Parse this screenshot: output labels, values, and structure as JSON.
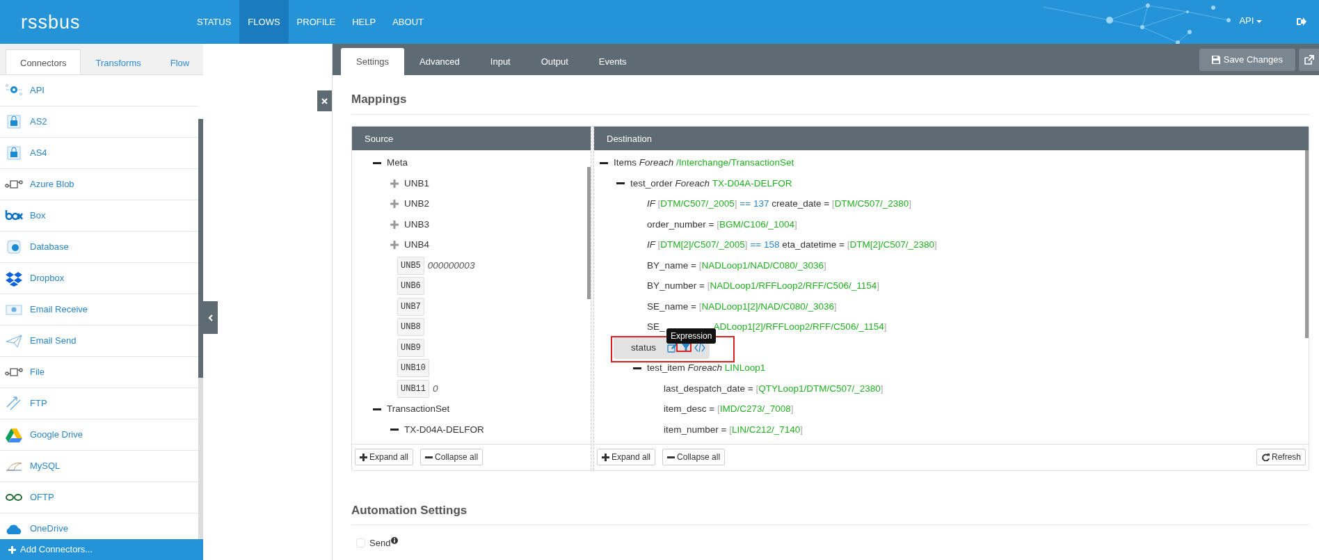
{
  "navbar": {
    "logo": "rssbus",
    "items": [
      {
        "label": "STATUS",
        "selected": false
      },
      {
        "label": "FLOWS",
        "selected": true
      },
      {
        "label": "PROFILE",
        "selected": false
      },
      {
        "label": "HELP",
        "selected": false
      },
      {
        "label": "ABOUT",
        "selected": false
      }
    ],
    "user_menu": "API"
  },
  "sidebar": {
    "tabs": [
      {
        "label": "Connectors",
        "selected": true
      },
      {
        "label": "Transforms",
        "selected": false
      },
      {
        "label": "Flow",
        "selected": false
      }
    ],
    "connectors": [
      "API",
      "AS2",
      "AS4",
      "Azure Blob",
      "Box",
      "Database",
      "Dropbox",
      "Email Receive",
      "Email Send",
      "File",
      "FTP",
      "Google Drive",
      "MySQL",
      "OFTP",
      "OneDrive"
    ],
    "add_button": "Add Connectors..."
  },
  "main": {
    "tabs": [
      {
        "label": "Settings",
        "selected": true
      },
      {
        "label": "Advanced",
        "selected": false
      },
      {
        "label": "Input",
        "selected": false
      },
      {
        "label": "Output",
        "selected": false
      },
      {
        "label": "Events",
        "selected": false
      }
    ],
    "save_button": "Save Changes",
    "mappings": {
      "title": "Mappings",
      "source": {
        "title": "Source",
        "nodes": [
          {
            "kind": "branch",
            "label": "Meta",
            "expanded": true,
            "children": [
              {
                "kind": "branch",
                "label": "UNB1",
                "expanded": false
              },
              {
                "kind": "branch",
                "label": "UNB2",
                "expanded": false
              },
              {
                "kind": "branch",
                "label": "UNB3",
                "expanded": false
              },
              {
                "kind": "branch",
                "label": "UNB4",
                "expanded": false
              },
              {
                "kind": "field",
                "label": "UNB5",
                "value": "000000003"
              },
              {
                "kind": "field",
                "label": "UNB6"
              },
              {
                "kind": "field",
                "label": "UNB7"
              },
              {
                "kind": "field",
                "label": "UNB8"
              },
              {
                "kind": "field",
                "label": "UNB9"
              },
              {
                "kind": "field",
                "label": "UNB10"
              },
              {
                "kind": "field",
                "label": "UNB11",
                "value": "0"
              }
            ]
          },
          {
            "kind": "branch",
            "label": "TransactionSet",
            "expanded": true,
            "children": [
              {
                "kind": "branch",
                "label": "TX-D04A-DELFOR",
                "expanded": true
              }
            ]
          }
        ],
        "buttons": [
          "Expand all",
          "Collapse all"
        ]
      },
      "destination": {
        "title": "Destination",
        "nodes": [
          {
            "kind": "loop",
            "expanded": true,
            "parts": [
              {
                "kind": "plain",
                "text": "Items "
              },
              {
                "kind": "kw",
                "text": "Foreach "
              },
              {
                "kind": "path",
                "text": "/Interchange/TransactionSet"
              }
            ],
            "children": [
              {
                "kind": "loop",
                "expanded": true,
                "parts": [
                  {
                    "kind": "plain",
                    "text": "test_order "
                  },
                  {
                    "kind": "kw",
                    "text": "Foreach "
                  },
                  {
                    "kind": "path",
                    "text": "TX-D04A-DELFOR"
                  }
                ],
                "children": [
                  {
                    "kind": "mapping",
                    "parts": [
                      {
                        "kind": "kw",
                        "text": "IF "
                      },
                      {
                        "kind": "br",
                        "text": "["
                      },
                      {
                        "kind": "path",
                        "text": "DTM/C507/_2005"
                      },
                      {
                        "kind": "br",
                        "text": "]"
                      },
                      {
                        "kind": "num",
                        "text": " == 137 "
                      },
                      {
                        "kind": "plain",
                        "text": "create_date = "
                      },
                      {
                        "kind": "br",
                        "text": "["
                      },
                      {
                        "kind": "path",
                        "text": "DTM/C507/_2380"
                      },
                      {
                        "kind": "br",
                        "text": "]"
                      }
                    ]
                  },
                  {
                    "kind": "mapping",
                    "parts": [
                      {
                        "kind": "plain",
                        "text": "order_number = "
                      },
                      {
                        "kind": "br",
                        "text": "["
                      },
                      {
                        "kind": "path",
                        "text": "BGM/C106/_1004"
                      },
                      {
                        "kind": "br",
                        "text": "]"
                      }
                    ]
                  },
                  {
                    "kind": "mapping",
                    "parts": [
                      {
                        "kind": "kw",
                        "text": "IF "
                      },
                      {
                        "kind": "br",
                        "text": "["
                      },
                      {
                        "kind": "path",
                        "text": "DTM[2]/C507/_2005"
                      },
                      {
                        "kind": "br",
                        "text": "]"
                      },
                      {
                        "kind": "num",
                        "text": " == 158 "
                      },
                      {
                        "kind": "plain",
                        "text": "eta_datetime = "
                      },
                      {
                        "kind": "br",
                        "text": "["
                      },
                      {
                        "kind": "path",
                        "text": "DTM[2]/C507/_2380"
                      },
                      {
                        "kind": "br",
                        "text": "]"
                      }
                    ]
                  },
                  {
                    "kind": "mapping",
                    "parts": [
                      {
                        "kind": "plain",
                        "text": "BY_name = "
                      },
                      {
                        "kind": "br",
                        "text": "["
                      },
                      {
                        "kind": "path",
                        "text": "NADLoop1/NAD/C080/_3036"
                      },
                      {
                        "kind": "br",
                        "text": "]"
                      }
                    ]
                  },
                  {
                    "kind": "mapping",
                    "parts": [
                      {
                        "kind": "plain",
                        "text": "BY_number = "
                      },
                      {
                        "kind": "br",
                        "text": "["
                      },
                      {
                        "kind": "path",
                        "text": "NADLoop1/RFFLoop2/RFF/C506/_1154"
                      },
                      {
                        "kind": "br",
                        "text": "]"
                      }
                    ]
                  },
                  {
                    "kind": "mapping",
                    "parts": [
                      {
                        "kind": "plain",
                        "text": "SE_name = "
                      },
                      {
                        "kind": "br",
                        "text": "["
                      },
                      {
                        "kind": "path",
                        "text": "NADLoop1[2]/NAD/C080/_3036"
                      },
                      {
                        "kind": "br",
                        "text": "]"
                      }
                    ]
                  },
                  {
                    "kind": "mapping",
                    "parts": [
                      {
                        "kind": "plain",
                        "text": "SE_"
                      }
                    ],
                    "tail": [
                      {
                        "kind": "path",
                        "text": "ADLoop1[2]/RFFLoop2/RFF/C506/_1154"
                      },
                      {
                        "kind": "br",
                        "text": "]"
                      }
                    ]
                  },
                  {
                    "kind": "field",
                    "label": "status",
                    "selected": true,
                    "tooltip": "Expression",
                    "annotated": true
                  },
                  {
                    "kind": "loop",
                    "expanded": true,
                    "parts": [
                      {
                        "kind": "plain",
                        "text": "test_item "
                      },
                      {
                        "kind": "kw",
                        "text": "Foreach "
                      },
                      {
                        "kind": "path",
                        "text": "LINLoop1"
                      }
                    ],
                    "children": [
                      {
                        "kind": "mapping",
                        "parts": [
                          {
                            "kind": "plain",
                            "text": "last_despatch_date = "
                          },
                          {
                            "kind": "br",
                            "text": "["
                          },
                          {
                            "kind": "path",
                            "text": "QTYLoop1/DTM/C507/_2380"
                          },
                          {
                            "kind": "br",
                            "text": "]"
                          }
                        ]
                      },
                      {
                        "kind": "mapping",
                        "parts": [
                          {
                            "kind": "plain",
                            "text": "item_desc = "
                          },
                          {
                            "kind": "br",
                            "text": "["
                          },
                          {
                            "kind": "path",
                            "text": "IMD/C273/_7008"
                          },
                          {
                            "kind": "br",
                            "text": "]"
                          }
                        ]
                      },
                      {
                        "kind": "mapping",
                        "parts": [
                          {
                            "kind": "plain",
                            "text": "item_number = "
                          },
                          {
                            "kind": "br",
                            "text": "["
                          },
                          {
                            "kind": "path",
                            "text": "LIN/C212/_7140"
                          },
                          {
                            "kind": "br",
                            "text": "]"
                          }
                        ]
                      }
                    ]
                  }
                ]
              }
            ]
          }
        ],
        "buttons": [
          "Expand all",
          "Collapse all"
        ],
        "refresh_button": "Refresh"
      }
    },
    "automation": {
      "title": "Automation Settings",
      "options": [
        {
          "label": "Send",
          "checked": false
        }
      ]
    }
  }
}
